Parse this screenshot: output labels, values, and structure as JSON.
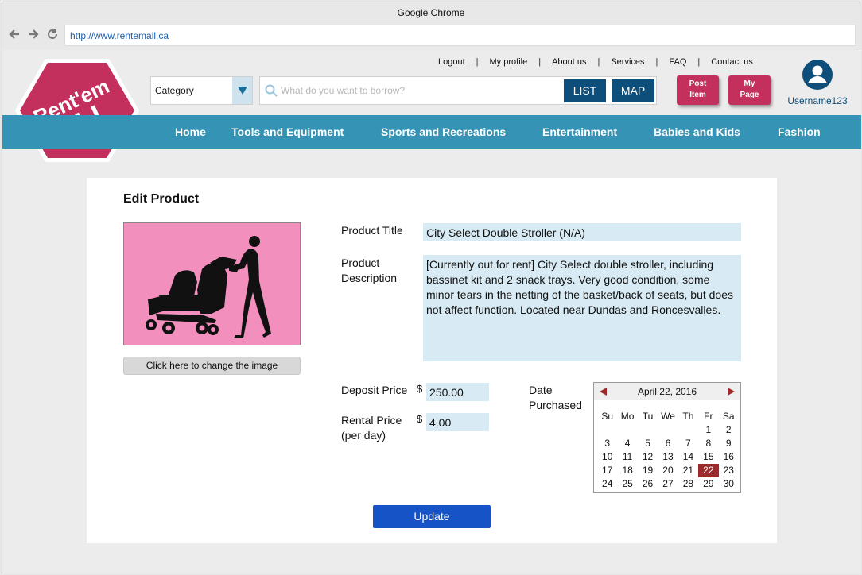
{
  "window": {
    "title": "Google Chrome"
  },
  "browser": {
    "url": "http://www.rentemall.ca"
  },
  "logo": {
    "line1": "Rent'em",
    "line2": "ALL",
    "color": "#c4305e"
  },
  "toplinks": [
    "Logout",
    "My profile",
    "About us",
    "Services",
    "FAQ",
    "Contact us"
  ],
  "search": {
    "category_label": "Category",
    "placeholder": "What do you want to borrow?",
    "list_label": "LIST",
    "map_label": "MAP"
  },
  "actions": {
    "post_item": [
      "Post",
      "Item"
    ],
    "my_page": [
      "My",
      "Page"
    ]
  },
  "user": {
    "username": "Username123"
  },
  "nav": [
    "Home",
    "Tools and Equipment",
    "Sports and Recreations",
    "Entertainment",
    "Babies and Kids",
    "Fashion"
  ],
  "edit": {
    "heading": "Edit Product",
    "change_image_label": "Click here to change the image",
    "product_title_label": "Product Title",
    "product_title_value": "City Select Double Stroller (N/A)",
    "description_label": [
      "Product",
      "Description"
    ],
    "description_value": "[Currently out for rent]  City Select double stroller, including bassinet kit and 2 snack trays. Very good condition, some minor tears in the netting of the basket/back of seats, but does not affect function. Located near Dundas and Roncesvalles.",
    "deposit_label": "Deposit Price",
    "deposit_currency": "$",
    "deposit_value": "250.00",
    "rental_label": [
      "Rental Price",
      "(per day)"
    ],
    "rental_currency": "$",
    "rental_value": "4.00",
    "date_label": [
      "Date",
      "Purchased"
    ],
    "update_label": "Update"
  },
  "calendar": {
    "month_label": "April 22, 2016",
    "weekdays": [
      "Su",
      "Mo",
      "Tu",
      "We",
      "Th",
      "Fr",
      "Sa"
    ],
    "weeks": [
      [
        "",
        "",
        "",
        "",
        "",
        "1",
        "2"
      ],
      [
        "3",
        "4",
        "5",
        "6",
        "7",
        "8",
        "9"
      ],
      [
        "10",
        "11",
        "12",
        "13",
        "14",
        "15",
        "16"
      ],
      [
        "17",
        "18",
        "19",
        "20",
        "21",
        "22",
        "23"
      ],
      [
        "24",
        "25",
        "26",
        "27",
        "28",
        "29",
        "30"
      ]
    ],
    "selected_day": "22",
    "selected_color": "#9c2a2a"
  },
  "colors": {
    "nav_bar": "#3594b5",
    "button_dark": "#0d4f7a",
    "accent_pink": "#c4305e",
    "update_button": "#1553c7",
    "field_bg": "#d8eaf3"
  }
}
